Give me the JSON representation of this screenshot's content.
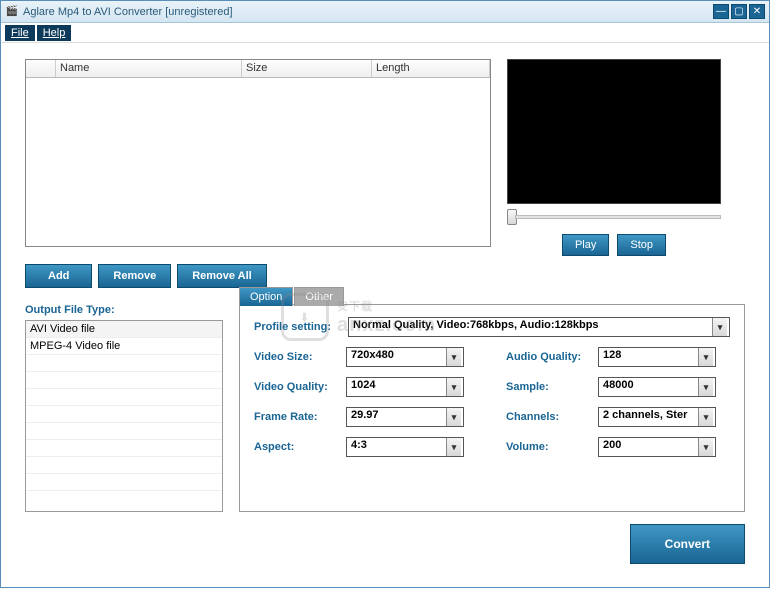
{
  "window": {
    "title": "Aglare Mp4 to AVI Converter  [unregistered]"
  },
  "menu": {
    "file": "File",
    "help": "Help"
  },
  "table": {
    "headers": {
      "name": "Name",
      "size": "Size",
      "length": "Length"
    }
  },
  "player": {
    "play": "Play",
    "stop": "Stop"
  },
  "actions": {
    "add": "Add",
    "remove": "Remove",
    "removeAll": "Remove All"
  },
  "outputType": {
    "label": "Output File Type:",
    "items": [
      "AVI Video file",
      "MPEG-4 Video file"
    ]
  },
  "tabs": {
    "option": "Option",
    "other": "Other"
  },
  "settings": {
    "profileLabel": "Profile setting:",
    "profileValue": "Normal Quality, Video:768kbps, Audio:128kbps",
    "left": {
      "videoSize": {
        "label": "Video Size:",
        "value": "720x480"
      },
      "videoQuality": {
        "label": "Video Quality:",
        "value": "1024"
      },
      "frameRate": {
        "label": "Frame Rate:",
        "value": "29.97"
      },
      "aspect": {
        "label": "Aspect:",
        "value": "4:3"
      }
    },
    "right": {
      "audioQuality": {
        "label": "Audio Quality:",
        "value": "128"
      },
      "sample": {
        "label": "Sample:",
        "value": "48000"
      },
      "channels": {
        "label": "Channels:",
        "value": "2 channels, Ster"
      },
      "volume": {
        "label": "Volume:",
        "value": "200"
      }
    }
  },
  "convert": "Convert",
  "watermark": {
    "text1": "安下载",
    "text2": "anxz.com"
  }
}
